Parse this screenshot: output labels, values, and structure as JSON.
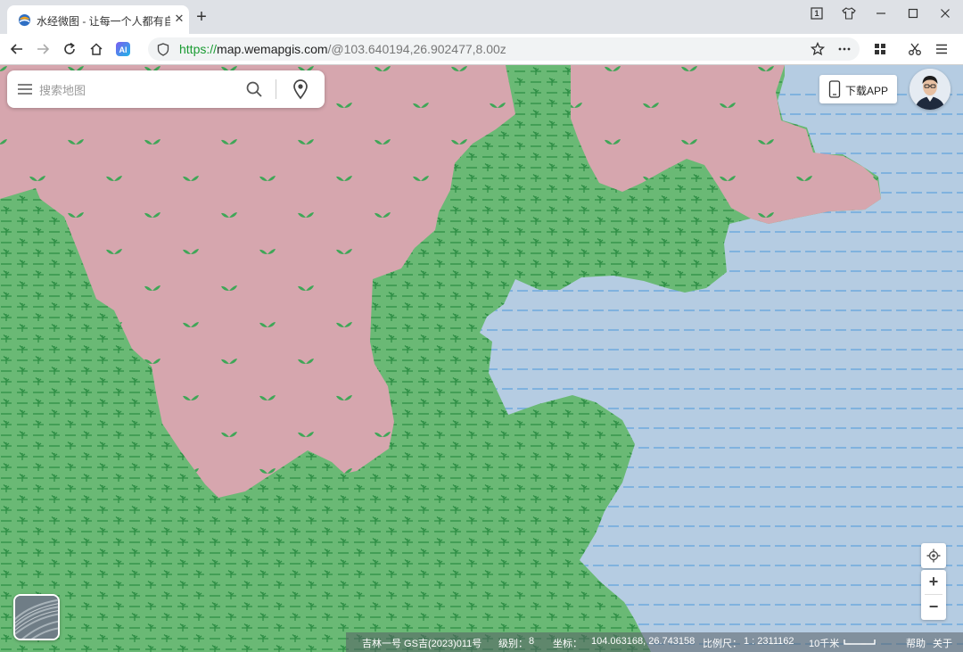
{
  "browser": {
    "tab_title": "水经微图 - 让每一个人都有自",
    "url_scheme": "https://",
    "url_host": "map.wemapgis.com",
    "url_rest": "/@103.640194,26.902477,8.00z",
    "tab_counter": "1"
  },
  "search": {
    "placeholder": "搜索地图"
  },
  "header": {
    "download_app_label": "下载APP"
  },
  "map": {
    "colors": {
      "forest": "#6ab975",
      "forest_symbol": "#2e8e45",
      "plain": "#d6a6ae",
      "plain_symbol": "#3fa657",
      "water": "#b5cce2",
      "water_symbol": "#6aa6dc"
    },
    "zoom_in_label": "+",
    "zoom_out_label": "−"
  },
  "statusbar": {
    "copyright": "吉林一号 GS吉(2023)011号",
    "level_label": "级别：",
    "level_value": "8",
    "coord_label": "坐标：",
    "coord_value": "104.063168, 26.743158",
    "scale_label": "比例尺：",
    "scale_value": "1 : 2311162",
    "scalebar_text": "10千米",
    "help": "帮助",
    "about": "关于"
  }
}
